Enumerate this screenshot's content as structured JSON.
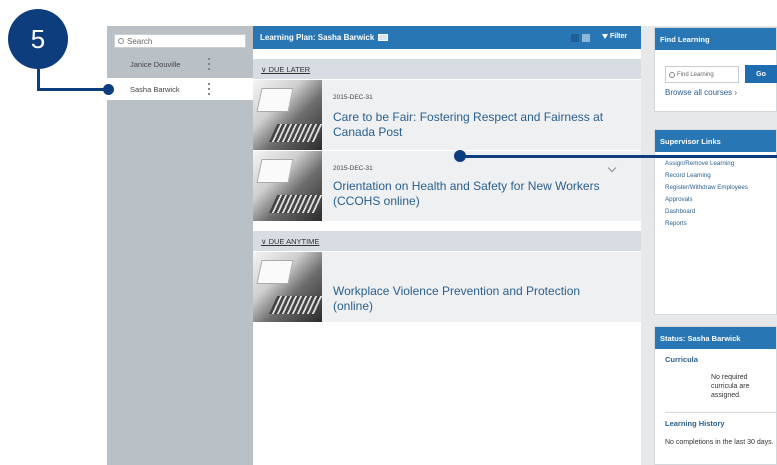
{
  "callout": {
    "number": "5"
  },
  "employee_panel": {
    "search_placeholder": "Search",
    "employees": [
      {
        "name": "Janice Douville",
        "selected": false
      },
      {
        "name": "Sasha Barwick",
        "selected": true
      }
    ]
  },
  "learning_plan": {
    "header": "Learning Plan: Sasha Barwick",
    "filter_label": "Filter",
    "sections": [
      {
        "label": "DUE LATER"
      },
      {
        "label": "DUE ANYTIME"
      }
    ],
    "courses": [
      {
        "due": "2015-DEC-31",
        "title": "Care to be Fair: Fostering Respect and Fairness at Canada Post"
      },
      {
        "due": "2015-DEC-31",
        "title": "Orientation on Health and Safety for New Workers (CCOHS online)"
      },
      {
        "due": "",
        "title": "Workplace Violence Prevention and Protection (online)"
      }
    ]
  },
  "find_learning": {
    "header": "Find Learning",
    "input_placeholder": "Find Learning",
    "go_label": "Go",
    "browse_label": "Browse all courses ›"
  },
  "supervisor_links": {
    "header": "Supervisor Links",
    "links": [
      "Assign/Remove Learning",
      "Record Learning",
      "Register/Withdraw Employees",
      "Approvals",
      "Dashboard",
      "Reports"
    ]
  },
  "status": {
    "header": "Status: Sasha Barwick",
    "curricula_label": "Curricula",
    "curricula_msg": "No required curricula are assigned.",
    "history_label": "Learning History",
    "history_msg": "No completions in the last 30 days."
  },
  "colors": {
    "accent": "#2876b4",
    "callout": "#0e3d7e",
    "link": "#2a5f8c"
  }
}
